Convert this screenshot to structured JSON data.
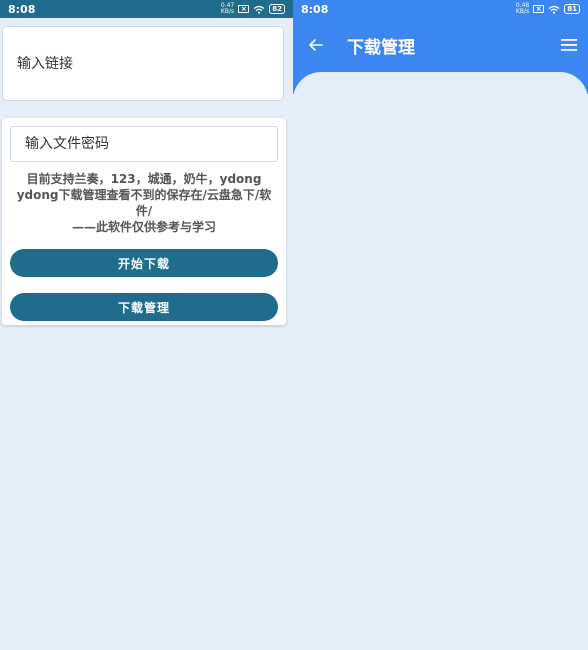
{
  "left": {
    "status_bar": {
      "time": "8:08",
      "net_speed_value": "0.47",
      "net_speed_unit": "KB/s",
      "battery": "82"
    },
    "url_input": {
      "placeholder": "输入链接"
    },
    "password_input": {
      "placeholder": "输入文件密码"
    },
    "notice_lines": [
      "目前支持兰奏，123，城通，奶牛，ydong",
      "ydong下载管理查看不到的保存在/云盘急下/软件/",
      "——此软件仅供参考与学习"
    ],
    "start_button_label": "开始下载",
    "manage_button_label": "下载管理"
  },
  "right": {
    "status_bar": {
      "time": "8:08",
      "net_speed_value": "0.48",
      "net_speed_unit": "KB/s",
      "battery": "81"
    },
    "app_bar": {
      "title": "下载管理"
    }
  },
  "colors": {
    "left_primary": "#1f6c8c",
    "right_primary": "#3b86f0",
    "background": "#e3eef8"
  },
  "icons": [
    "back-arrow-icon",
    "menu-icon",
    "wifi-icon",
    "sim-icon",
    "battery-icon"
  ]
}
